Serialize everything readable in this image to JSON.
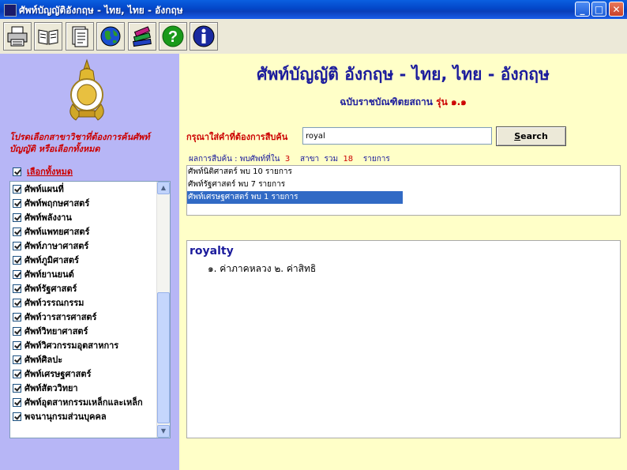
{
  "window": {
    "title": "ศัพท์บัญญัติอังกฤษ - ไทย, ไทย - อังกฤษ"
  },
  "toolbar": {
    "icons": [
      "printer-icon",
      "book-icon",
      "document-icon",
      "globe-icon",
      "books-stack-icon",
      "help-icon",
      "info-icon"
    ]
  },
  "left_panel": {
    "instruction": "โปรดเลือกสาขาวิชาที่ต้องการค้นศัพท์บัญญัติ หรือเลือกทั้งหมด",
    "select_all_label": "เลือกทั้งหมด",
    "subjects": [
      "ศัพท์แผนที่",
      "ศัพท์พฤกษศาสตร์",
      "ศัพท์พลังงาน",
      "ศัพท์แพทยศาสตร์",
      "ศัพท์ภาษาศาสตร์",
      "ศัพท์ภูมิศาสตร์",
      "ศัพท์ยานยนต์",
      "ศัพท์รัฐศาสตร์",
      "ศัพท์วรรณกรรม",
      "ศัพท์วารสารศาสตร์",
      "ศัพท์วิทยาศาสตร์",
      "ศัพท์วิศวกรรมอุตสาหการ",
      "ศัพท์ศิลปะ",
      "ศัพท์เศรษฐศาสตร์",
      "ศัพท์สัตววิทยา",
      "ศัพท์อุตสาหกรรมเหล็กและเหล็ก",
      "พจนานุกรมส่วนบุคคล"
    ]
  },
  "main": {
    "title": "ศัพท์บัญญัติ อังกฤษ - ไทย, ไทย - อังกฤษ",
    "edition_prefix": "ฉบับราชบัณฑิตยสถาน ",
    "edition_version": "รุ่น ๑.๑",
    "search_label": "กรุณาใส่คำที่ต้องการสืบค้น",
    "search_value": "royal",
    "search_button": "Search",
    "summary": {
      "prefix": "ผลการสืบค้น : พบศัพท์ที่ใน",
      "branches": "3",
      "branches_unit": "สาขา",
      "total_label": "รวม",
      "total": "18",
      "total_unit": "รายการ"
    },
    "results": [
      "ศัพท์นิติศาสตร์ พบ 10 รายการ",
      "ศัพท์รัฐศาสตร์ พบ 7 รายการ",
      "ศัพท์เศรษฐศาสตร์ พบ 1 รายการ"
    ],
    "selected_result": 2,
    "definition": {
      "word": "royalty",
      "meaning": "๑. ค่าภาคหลวง ๒. ค่าสิทธิ"
    }
  }
}
